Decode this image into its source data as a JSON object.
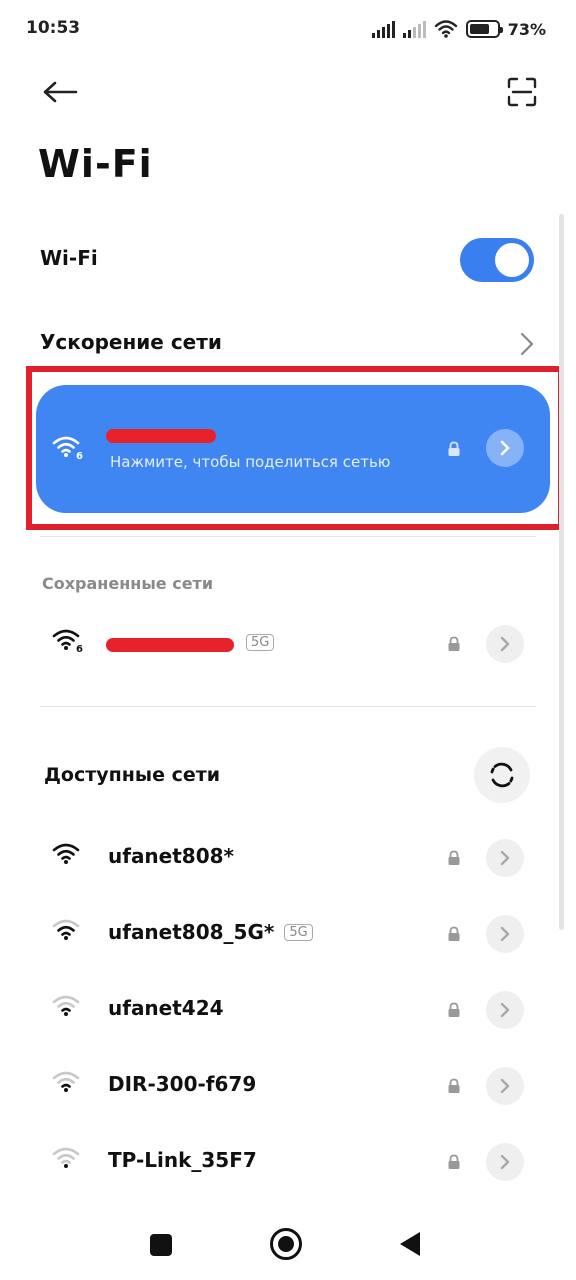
{
  "status_bar": {
    "time": "10:53",
    "battery_percent": "73%",
    "battery_level": 0.73,
    "icons": [
      "signal-icon",
      "signal-icon",
      "wifi-icon",
      "battery-icon"
    ]
  },
  "header": {
    "back_icon": "arrow-left-icon",
    "scan_icon": "qr-scan-icon",
    "title": "Wi-Fi"
  },
  "wifi_toggle": {
    "label": "Wi-Fi",
    "on": true
  },
  "network_boost": {
    "label": "Ускорение сети"
  },
  "connected": {
    "name": "",
    "subtitle": "Нажмите, чтобы поделиться сетью",
    "wifi_standard": "6"
  },
  "saved": {
    "title": "Сохраненные сети",
    "networks": [
      {
        "ssid": "",
        "badge": "5G",
        "wifi_standard": "6",
        "signal": 4
      }
    ]
  },
  "available": {
    "title": "Доступные сети",
    "networks": [
      {
        "ssid": "ufanet808*",
        "badge": "",
        "signal": 4
      },
      {
        "ssid": "ufanet808_5G*",
        "badge": "5G",
        "signal": 3
      },
      {
        "ssid": "ufanet424",
        "badge": "",
        "signal": 2
      },
      {
        "ssid": "DIR-300-f679",
        "badge": "",
        "signal": 2
      },
      {
        "ssid": "TP-Link_35F7",
        "badge": "",
        "signal": 1
      }
    ]
  },
  "nav": {
    "recent_icon": "square-icon",
    "home_icon": "circle-icon",
    "back_icon": "triangle-back-icon"
  },
  "colors": {
    "accent": "#3f86f3",
    "highlight": "#e0202a",
    "redaction": "#e8222a"
  }
}
